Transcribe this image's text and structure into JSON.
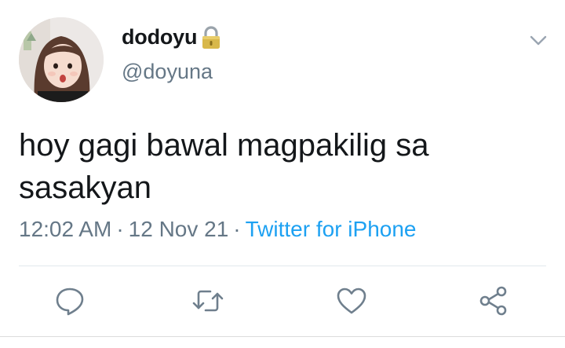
{
  "user": {
    "display_name": "dodoyu",
    "handle": "@doyuna",
    "protected_icon": "lock-icon"
  },
  "tweet": {
    "text": "hoy gagi bawal magpakilig sa sasakyan",
    "time": "12:02 AM",
    "date": "12 Nov 21",
    "separator": "·",
    "source": "Twitter for iPhone"
  },
  "actions": {
    "icons": [
      "reply-icon",
      "retweet-icon",
      "like-icon",
      "share-icon"
    ]
  },
  "colors": {
    "text": "#14171a",
    "secondary": "#657786",
    "link": "#1da1f2",
    "divider": "#e1e8ed"
  }
}
